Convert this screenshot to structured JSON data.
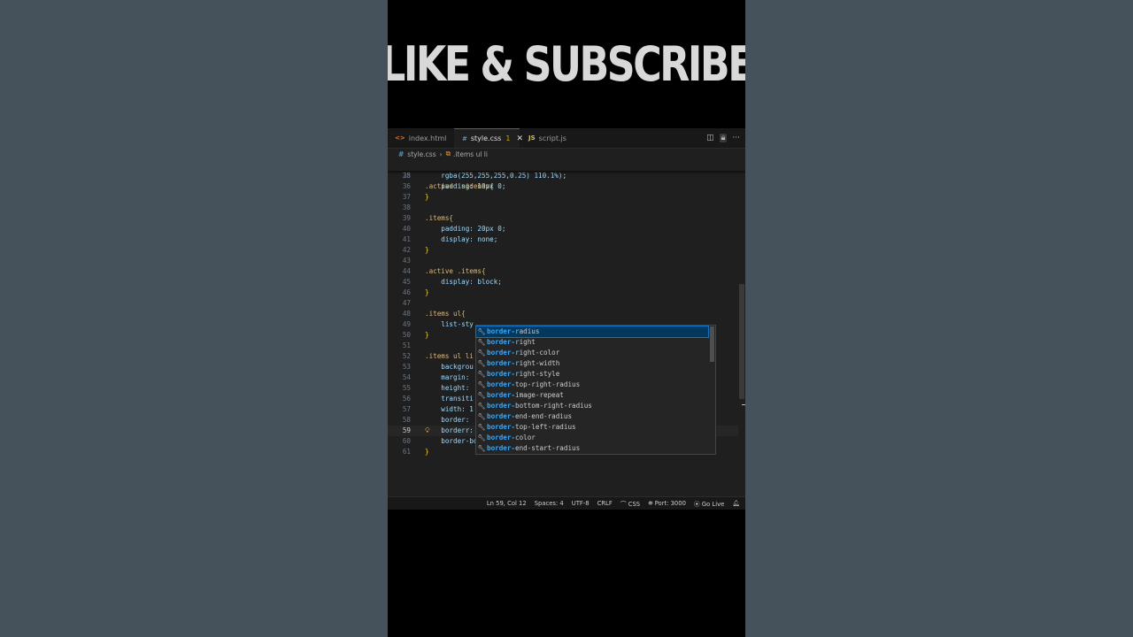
{
  "banner": {
    "text": "LIKE & SUBSCRIBE"
  },
  "tabs": [
    {
      "icon": "<>",
      "label": "index.html",
      "active": false
    },
    {
      "icon": "#",
      "label": "style.css",
      "badge": "1",
      "close": "✕",
      "active": true
    },
    {
      "icon": "JS",
      "label": "script.js",
      "active": false
    }
  ],
  "tab_actions": {
    "split": "split-editor-icon",
    "lock": "lock-icon",
    "more": "···"
  },
  "breadcrumb": {
    "file": "style.css",
    "symbol": ".items ul li"
  },
  "editor": {
    "sticky": {
      "num": "28",
      "text": ".active .sidenav{"
    },
    "lines": [
      {
        "num": "35",
        "text": "    rgba(255,255,255,0.25) 110.1%);"
      },
      {
        "num": "36",
        "text": "    padding: 10px 0;"
      },
      {
        "num": "37",
        "text": "}"
      },
      {
        "num": "38",
        "text": ""
      },
      {
        "num": "39",
        "text": ".items{"
      },
      {
        "num": "40",
        "text": "    padding: 20px 0;"
      },
      {
        "num": "41",
        "text": "    display: none;"
      },
      {
        "num": "42",
        "text": "}"
      },
      {
        "num": "43",
        "text": ""
      },
      {
        "num": "44",
        "text": ".active .items{"
      },
      {
        "num": "45",
        "text": "    display: block;"
      },
      {
        "num": "46",
        "text": "}"
      },
      {
        "num": "47",
        "text": ""
      },
      {
        "num": "48",
        "text": ".items ul{"
      },
      {
        "num": "49",
        "text": "    list-sty"
      },
      {
        "num": "50",
        "text": "}"
      },
      {
        "num": "51",
        "text": ""
      },
      {
        "num": "52",
        "text": ".items ul li"
      },
      {
        "num": "53",
        "text": "    backgrou"
      },
      {
        "num": "54",
        "text": "    margin: "
      },
      {
        "num": "55",
        "text": "    height: "
      },
      {
        "num": "56",
        "text": "    transiti"
      },
      {
        "num": "57",
        "text": "    width: 1"
      },
      {
        "num": "58",
        "text": "    border: "
      },
      {
        "num": "59",
        "text": "    borderr: 1px solid rgba(255, 255, 255, 0.2);"
      },
      {
        "num": "60",
        "text": "    border-bottom: 1px solid rgba(255, 255, 255, 0.2);"
      },
      {
        "num": "61",
        "text": "}"
      }
    ]
  },
  "suggestions": [
    {
      "match": "border-r",
      "rest": "adius",
      "selected": true
    },
    {
      "match": "border-r",
      "rest": "ight"
    },
    {
      "match": "border-r",
      "rest": "ight-color"
    },
    {
      "match": "border-r",
      "rest": "ight-width"
    },
    {
      "match": "border-r",
      "rest": "ight-style"
    },
    {
      "match": "border-",
      "rest": "top-right-radius"
    },
    {
      "match": "border-",
      "rest": "image-repeat"
    },
    {
      "match": "border-",
      "rest": "bottom-right-radius"
    },
    {
      "match": "border-",
      "rest": "end-end-radius"
    },
    {
      "match": "border-",
      "rest": "top-left-radius"
    },
    {
      "match": "border-",
      "rest": "color"
    },
    {
      "match": "border-",
      "rest": "end-start-radius"
    }
  ],
  "status": {
    "position": "Ln 59, Col 12",
    "spaces": "Spaces: 4",
    "encoding": "UTF-8",
    "eol": "CRLF",
    "language": "CSS",
    "port": "Port: 3000",
    "golive": "Go Live"
  },
  "colors": {
    "accent": "#0078d4",
    "background": "#45525b",
    "editor": "#1f1f1f"
  }
}
